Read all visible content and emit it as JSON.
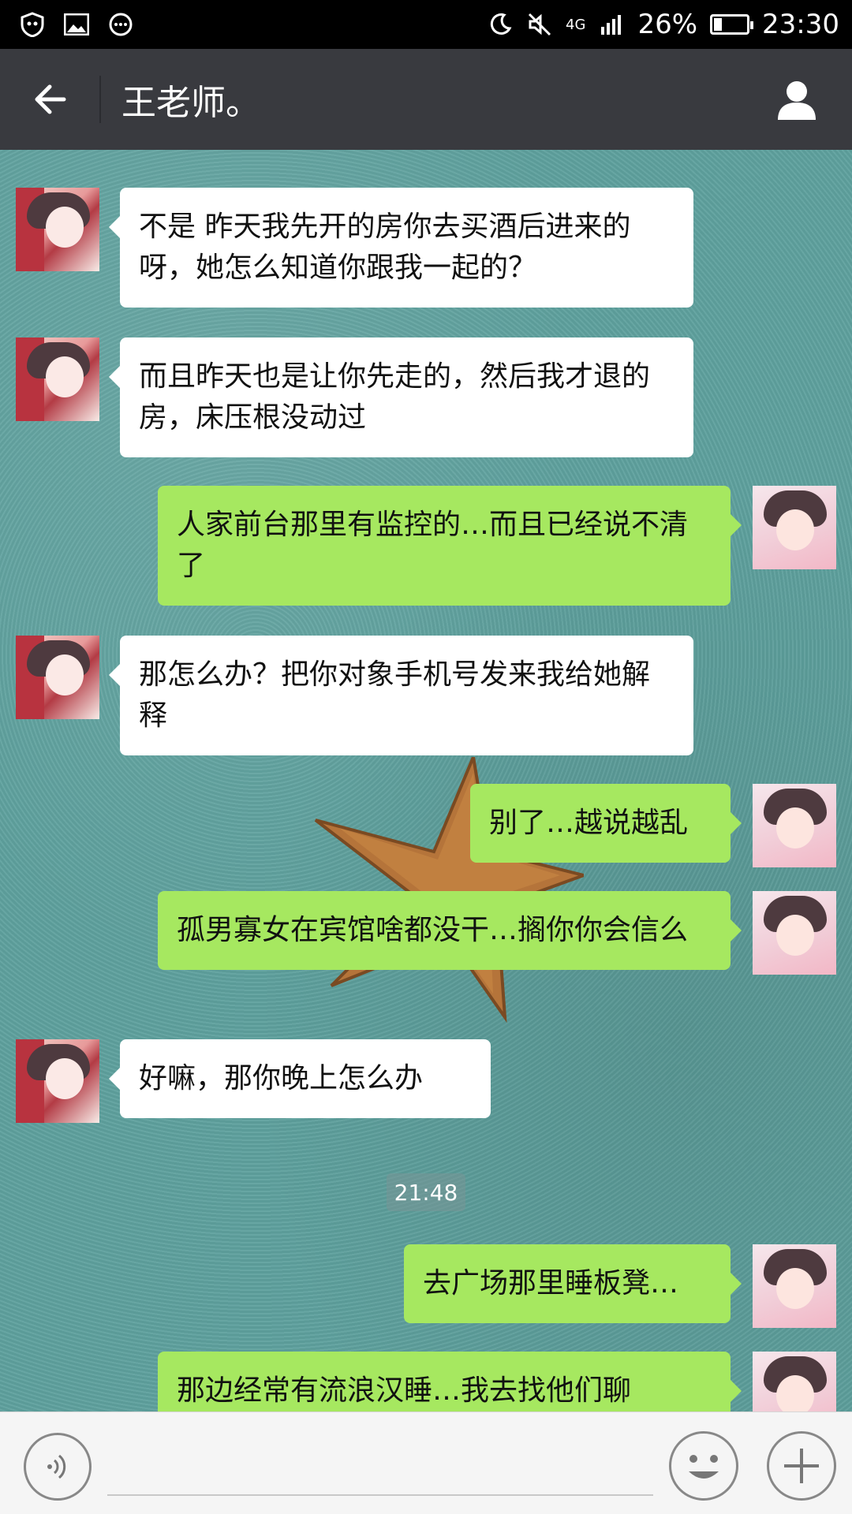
{
  "status_bar": {
    "network": "4G",
    "battery": "26%",
    "battery_level": 0.26,
    "time": "23:30",
    "icons": [
      "shield-icon",
      "gallery-icon",
      "chat-bubble-icon",
      "moon-icon",
      "mute-icon",
      "signal-icon",
      "battery-icon"
    ]
  },
  "header": {
    "title": "王老师。",
    "back_icon": "arrow-left-icon",
    "profile_icon": "person-icon"
  },
  "messages": [
    {
      "side": "in",
      "text": "不是 昨天我先开的房你去买酒后进来的呀，她怎么知道你跟我一起的？"
    },
    {
      "side": "in",
      "text": "而且昨天也是让你先走的，然后我才退的房，床压根没动过"
    },
    {
      "side": "out",
      "text": "人家前台那里有监控的…而且已经说不清了"
    },
    {
      "side": "in",
      "text": "那怎么办？把你对象手机号发来我给她解释"
    },
    {
      "side": "out",
      "text": "别了…越说越乱"
    },
    {
      "side": "out",
      "text": "孤男寡女在宾馆啥都没干…搁你你会信么"
    },
    {
      "side": "in",
      "text": "好嘛，那你晚上怎么办"
    },
    {
      "side": "out",
      "text": "去广场那里睡板凳…"
    },
    {
      "side": "out",
      "text": "那边经常有流浪汉睡…我去找他们聊"
    }
  ],
  "timestamp": "21:48",
  "input_bar": {
    "voice_icon": "voice-icon",
    "text_value": "",
    "emoji_icon": "emoji-icon",
    "plus_icon": "plus-icon"
  },
  "colors": {
    "title_bar": "#393a3f",
    "outgoing_bubble": "#a6e860",
    "incoming_bubble": "#ffffff"
  }
}
